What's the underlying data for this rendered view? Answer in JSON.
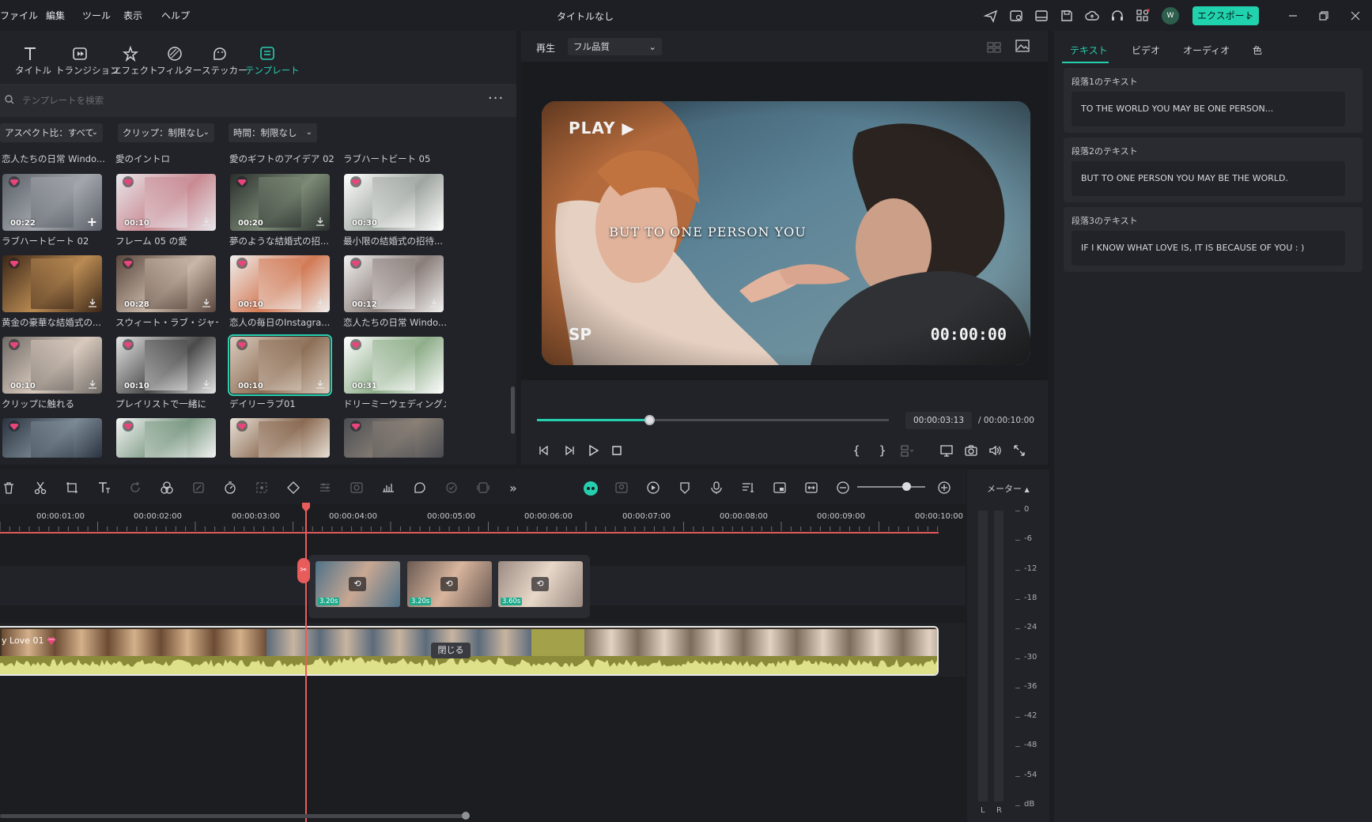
{
  "menu": {
    "items": [
      "ファイル",
      "編集",
      "ツール",
      "表示",
      "ヘルプ"
    ],
    "title": "タイトルなし",
    "avatar_initial": "W",
    "export_label": "エクスポート",
    "toolbar_icons": [
      "send-icon",
      "projects-icon",
      "layout-icon",
      "save-icon",
      "cloud-icon",
      "support-icon",
      "apps-icon"
    ],
    "window_icons": [
      "minimize-icon",
      "restore-icon",
      "close-icon"
    ]
  },
  "library": {
    "tabs": [
      {
        "label": "タイトル",
        "icon": "title-icon"
      },
      {
        "label": "トランジション",
        "icon": "transition-icon"
      },
      {
        "label": "エフェクト",
        "icon": "effects-icon"
      },
      {
        "label": "フィルター",
        "icon": "filter-icon"
      },
      {
        "label": "ステッカー",
        "icon": "sticker-icon"
      },
      {
        "label": "テンプレート",
        "icon": "template-icon",
        "active": true
      }
    ],
    "search_placeholder": "テンプレートを検索",
    "filters": [
      "アスペクト比：すべて",
      "クリップ：制限なし",
      "時間：制限なし"
    ],
    "header_labels": [
      "恋人たちの日常 Windo...",
      "愛のイントロ",
      "愛のギフトのアイデア 02",
      "ラブハートビート 05"
    ],
    "templates": [
      {
        "label": "ラブハートビート 02",
        "duration": "00:22",
        "colors": [
          "#5a5e66",
          "#a3a7ad"
        ],
        "action": "plus"
      },
      {
        "label": "フレーム 05 の愛",
        "duration": "00:10",
        "colors": [
          "#e8e6ea",
          "#c98a92"
        ]
      },
      {
        "label": "夢のような結婚式の招...",
        "duration": "00:20",
        "colors": [
          "#2a2f2d",
          "#7c8a76"
        ]
      },
      {
        "label": "最小限の結婚式の招待...",
        "duration": "00:30",
        "colors": [
          "#ffffff",
          "#9fa6a0"
        ]
      },
      {
        "label": "黄金の豪華な結婚式の...",
        "duration": "",
        "colors": [
          "#3a2618",
          "#b98a52"
        ]
      },
      {
        "label": "スウィート・ラブ・ジャーニー",
        "duration": "00:28",
        "colors": [
          "#5a463e",
          "#c9b8a8"
        ]
      },
      {
        "label": "恋人の毎日のInstagra...",
        "duration": "00:10",
        "colors": [
          "#f0efee",
          "#d27a55"
        ]
      },
      {
        "label": "恋人たちの日常 Windo...",
        "duration": "00:12",
        "colors": [
          "#f2f1f0",
          "#8a7e7a"
        ]
      },
      {
        "label": "クリップに触れる",
        "duration": "00:10",
        "colors": [
          "#6f6a66",
          "#d8c9bd"
        ]
      },
      {
        "label": "プレイリストで一緒に",
        "duration": "00:10",
        "colors": [
          "#e4e4e4",
          "#4a4a4a"
        ]
      },
      {
        "label": "デイリーラブ01",
        "duration": "00:10",
        "colors": [
          "#d9cbbd",
          "#8d6f57"
        ],
        "selected": true
      },
      {
        "label": "ドリーミーウェディングメモリ...",
        "duration": "00:31",
        "colors": [
          "#ffffff",
          "#8fae8a"
        ]
      },
      {
        "label": "",
        "duration": "",
        "colors": [
          "#2b3340",
          "#7b8a94"
        ]
      },
      {
        "label": "",
        "duration": "",
        "colors": [
          "#f4f4f4",
          "#7c9a84"
        ]
      },
      {
        "label": "",
        "duration": "",
        "colors": [
          "#e8e0d6",
          "#8a6a52"
        ]
      },
      {
        "label": "",
        "duration": "",
        "colors": [
          "#4a4c52",
          "#8a8076"
        ]
      }
    ]
  },
  "preview": {
    "play_label": "再生",
    "quality": "フル品質",
    "video_play_text": "PLAY ▶",
    "video_subtitle": "BUT TO ONE PERSON YOU",
    "video_sp": "SP",
    "video_timecode": "00:00:00",
    "current_time": "00:00:03:13",
    "total_time": "/ 00:00:10:00",
    "progress": 0.32
  },
  "right_panel": {
    "tabs": [
      "テキスト",
      "ビデオ",
      "オーディオ",
      "色"
    ],
    "active_tab": "テキスト",
    "sections": [
      {
        "heading": "段落1のテキスト",
        "text": "TO THE WORLD YOU MAY BE ONE PERSON..."
      },
      {
        "heading": "段落2のテキスト",
        "text": "BUT TO ONE PERSON YOU MAY BE THE WORLD."
      },
      {
        "heading": "段落3のテキスト",
        "text": "IF I KNOW WHAT LOVE IS, IT IS BECAUSE OF YOU : )"
      }
    ]
  },
  "timeline": {
    "ruler": [
      "00:00:01:00",
      "00:00:02:00",
      "00:00:03:00",
      "00:00:04:00",
      "00:00:05:00",
      "00:00:06:00",
      "00:00:07:00",
      "00:00:08:00",
      "00:00:09:00",
      "00:00:10:00"
    ],
    "compound_clips": [
      {
        "length": "3.20s",
        "colors": [
          "#4f7288",
          "#c9a893"
        ]
      },
      {
        "length": "3.20s",
        "colors": [
          "#6a5a52",
          "#d8b59d"
        ]
      },
      {
        "length": "3.60s",
        "colors": [
          "#9a8a82",
          "#e8d8c8"
        ]
      }
    ],
    "main_clip_label": "y Love 01",
    "close_label": "閉じる"
  },
  "meter": {
    "label": "メーター",
    "ticks": [
      "0",
      "-6",
      "-12",
      "-18",
      "-24",
      "-30",
      "-36",
      "-42",
      "-48",
      "-54",
      "dB"
    ],
    "channels": [
      "L",
      "R"
    ]
  }
}
